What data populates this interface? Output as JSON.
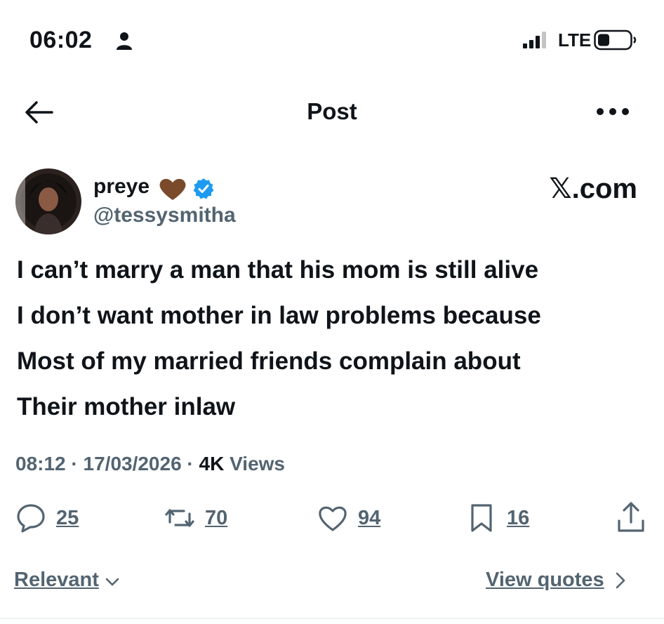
{
  "status_bar": {
    "time": "06:02",
    "network": "LTE",
    "icons": [
      "person-icon",
      "signal-icon",
      "battery-icon"
    ]
  },
  "header": {
    "title": "Post",
    "icons": [
      "back-arrow-icon",
      "more-icon"
    ]
  },
  "author": {
    "display_name": "preye",
    "handle": "@tessysmitha",
    "icons": [
      "brown-heart-emoji",
      "verified-badge-icon"
    ]
  },
  "brand": {
    "x": "𝕏",
    "rest": ".com"
  },
  "tweet": {
    "lines": [
      "I can’t marry a man that his mom is still alive",
      "I don’t want mother in law problems because",
      "Most of my married friends complain about",
      "Their mother inlaw"
    ]
  },
  "meta": {
    "time": "08:12",
    "sep1": " · ",
    "date": "17/03/2026",
    "sep2": " · ",
    "views_count": "4K",
    "views_label": " Views"
  },
  "actions": {
    "replies": "25",
    "reposts": "70",
    "likes": "94",
    "bookmarks": "16"
  },
  "footer": {
    "sort_label": "Relevant",
    "quotes_label": "View quotes"
  },
  "colors": {
    "text": "#0f1419",
    "secondary": "#536471",
    "verified": "#1d9bf0",
    "heart_emoji": "#7a4a2a"
  }
}
